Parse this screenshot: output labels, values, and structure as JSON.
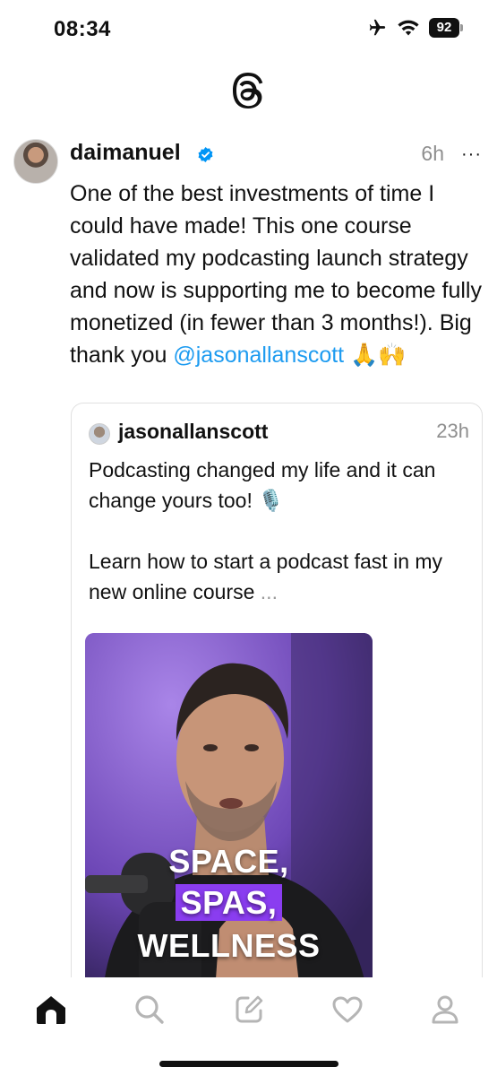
{
  "status_bar": {
    "time": "08:34",
    "battery": "92",
    "icons": [
      "airplane-icon",
      "wifi-icon",
      "battery-icon"
    ]
  },
  "header": {
    "logo": "threads-logo-icon"
  },
  "post": {
    "username": "daimanuel",
    "verified": true,
    "time": "6h",
    "more": "···",
    "text": "One of the best investments of time I could have made! This one course validated my podcasting launch strategy and now is supporting me to become fully monetized (in fewer than 3 months!). Big thank you ",
    "mention": "@jasonallanscott",
    "emoji": "🙏🙌"
  },
  "quoted_post": {
    "username": "jasonallanscott",
    "time": "23h",
    "text_line1": "Podcasting changed my life and it can change yours too! 🎙️",
    "text_line2": "Learn how to start a podcast fast in my new online course",
    "ellipsis": "...",
    "media": {
      "caption": [
        "SPACE,",
        "SPAS,",
        "WELLNESS"
      ],
      "highlight_color": "#8a3df0"
    }
  },
  "tab_bar": {
    "items": [
      "home-icon",
      "search-icon",
      "compose-icon",
      "activity-heart-icon",
      "profile-icon"
    ],
    "active": "home-icon"
  },
  "colors": {
    "mention": "#1d9bf0",
    "verified": "#0095f6",
    "muted": "#8e8e8e"
  }
}
